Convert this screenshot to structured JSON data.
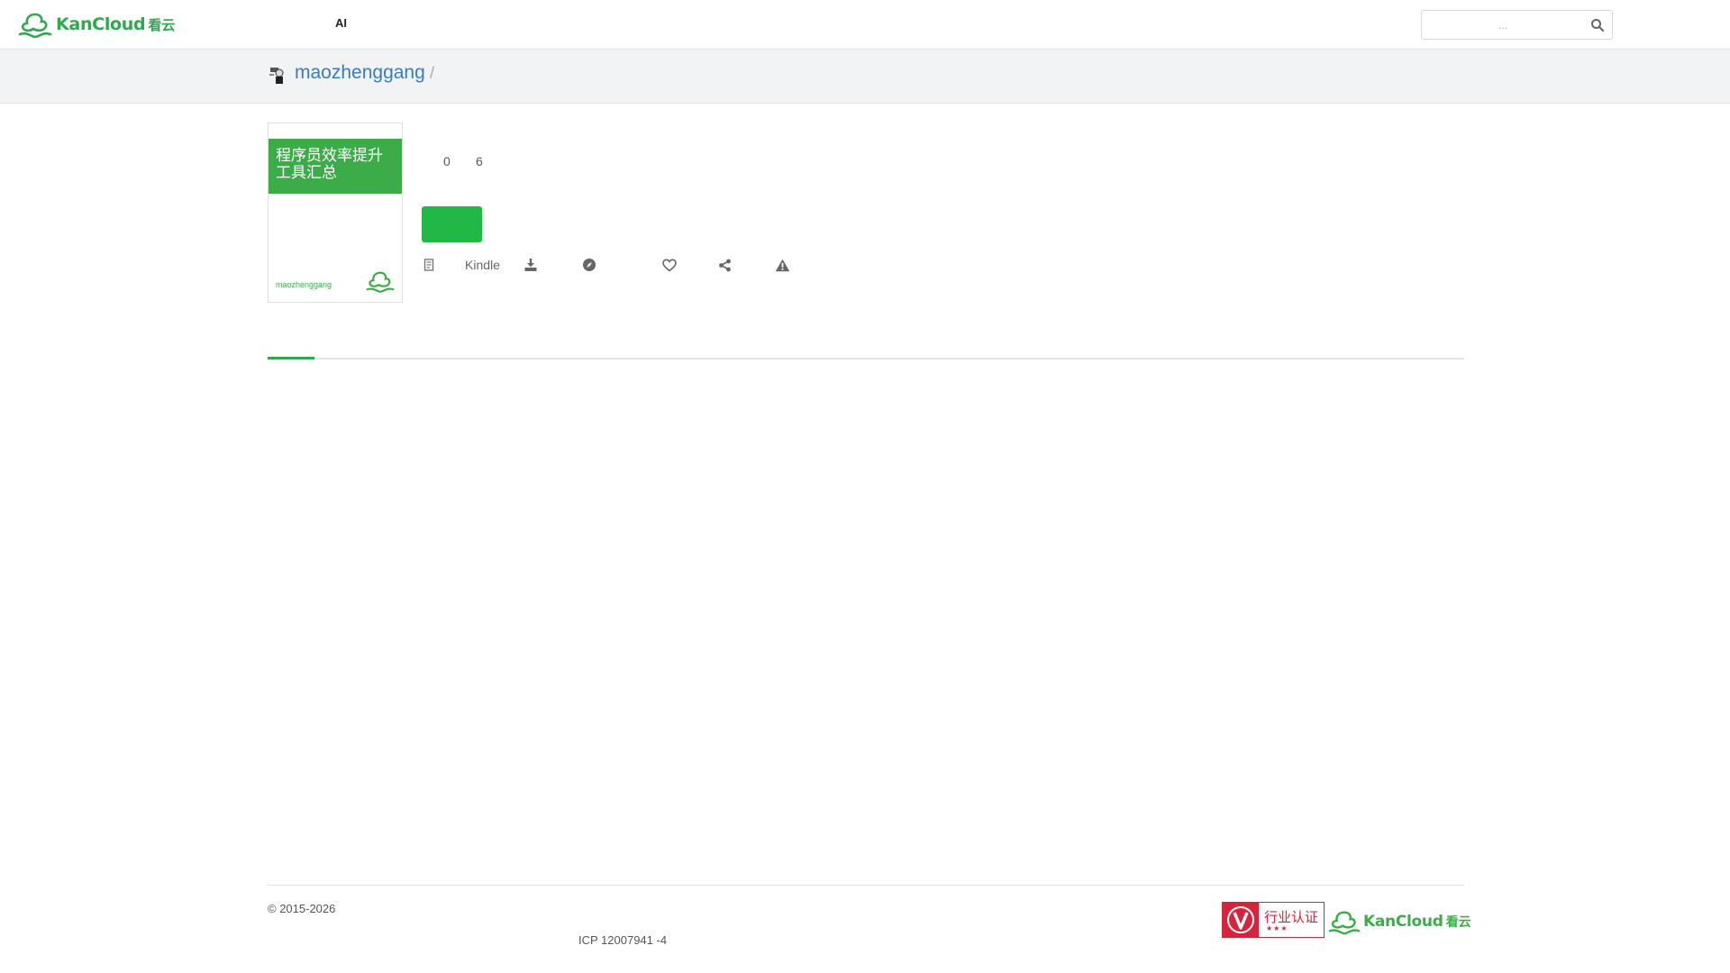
{
  "navbar": {
    "brand_text": "KanCloud",
    "brand_cn": "看云",
    "ai_link": "AI",
    "search_placeholder": "..."
  },
  "breadcrumb": {
    "user": "maozhenggang",
    "separator": "/"
  },
  "book": {
    "cover_title": "程序员效率提升工具汇总",
    "cover_author": "maozhenggang",
    "stat_a": "0",
    "stat_b": "6"
  },
  "actions": {
    "kindle_label": "Kindle"
  },
  "footer": {
    "copyright": "© 2015-2026",
    "icp": "ICP  12007941  -4",
    "cert_text": "行业认证",
    "cert_stars": "★★★",
    "brand_text": "KanCloud",
    "brand_cn": "看云"
  },
  "colors": {
    "brand_green": "#2fa94e",
    "button_green": "#21b845",
    "link_blue": "#3a7bbf",
    "cert_red": "#d6243d"
  }
}
